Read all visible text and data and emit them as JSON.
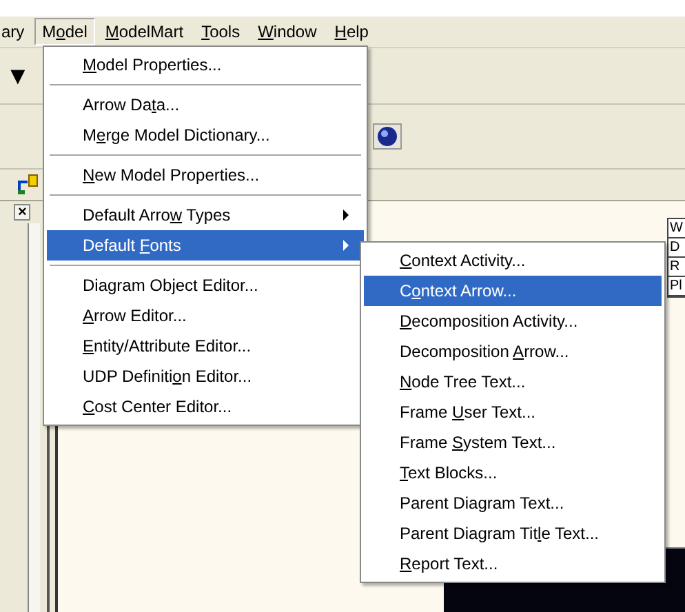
{
  "menu_bar": [
    {
      "label": {
        "after": "ary"
      },
      "open": false
    },
    {
      "label": {
        "before": "M",
        "key": "o",
        "after": "del"
      },
      "open": true
    },
    {
      "label": {
        "key": "M",
        "after": "odelMart"
      },
      "open": false
    },
    {
      "label": {
        "key": "T",
        "after": "ools"
      },
      "open": false
    },
    {
      "label": {
        "key": "W",
        "after": "indow"
      },
      "open": false
    },
    {
      "label": {
        "key": "H",
        "after": "elp"
      },
      "open": false
    }
  ],
  "model_menu": [
    {
      "kind": "item",
      "label": {
        "key": "M",
        "after": "odel Properties..."
      },
      "submenu": false,
      "selected": false
    },
    {
      "kind": "separator"
    },
    {
      "kind": "item",
      "label": {
        "before": "Arrow Da",
        "key": "t",
        "after": "a..."
      },
      "submenu": false,
      "selected": false
    },
    {
      "kind": "item",
      "label": {
        "before": "M",
        "key": "e",
        "after": "rge Model Dictionary..."
      },
      "submenu": false,
      "selected": false
    },
    {
      "kind": "separator"
    },
    {
      "kind": "item",
      "label": {
        "key": "N",
        "after": "ew Model Properties..."
      },
      "submenu": false,
      "selected": false
    },
    {
      "kind": "separator"
    },
    {
      "kind": "item",
      "label": {
        "before": "Default Arro",
        "key": "w",
        "after": " Types"
      },
      "submenu": true,
      "selected": false
    },
    {
      "kind": "item",
      "label": {
        "before": "Default ",
        "key": "F",
        "after": "onts"
      },
      "submenu": true,
      "selected": true
    },
    {
      "kind": "separator"
    },
    {
      "kind": "item",
      "label": {
        "before": "Diagram Object Editor..."
      },
      "submenu": false,
      "selected": false
    },
    {
      "kind": "item",
      "label": {
        "key": "A",
        "after": "rrow Editor..."
      },
      "submenu": false,
      "selected": false
    },
    {
      "kind": "item",
      "label": {
        "key": "E",
        "after": "ntity/Attribute Editor..."
      },
      "submenu": false,
      "selected": false
    },
    {
      "kind": "item",
      "label": {
        "before": "UDP Definiti",
        "key": "o",
        "after": "n Editor..."
      },
      "submenu": false,
      "selected": false
    },
    {
      "kind": "item",
      "label": {
        "key": "C",
        "after": "ost Center Editor..."
      },
      "submenu": false,
      "selected": false
    }
  ],
  "default_fonts_menu": [
    {
      "label": {
        "key": "C",
        "after": "ontext Activity..."
      },
      "selected": false
    },
    {
      "label": {
        "before": "C",
        "key": "o",
        "after": "ntext Arrow..."
      },
      "selected": true
    },
    {
      "label": {
        "key": "D",
        "after": "ecomposition Activity..."
      },
      "selected": false
    },
    {
      "label": {
        "before": "Decomposition ",
        "key": "A",
        "after": "rrow..."
      },
      "selected": false
    },
    {
      "label": {
        "key": "N",
        "after": "ode Tree Text..."
      },
      "selected": false
    },
    {
      "label": {
        "before": "Frame ",
        "key": "U",
        "after": "ser Text..."
      },
      "selected": false
    },
    {
      "label": {
        "before": "Frame ",
        "key": "S",
        "after": "ystem Text..."
      },
      "selected": false
    },
    {
      "label": {
        "key": "T",
        "after": "ext Blocks..."
      },
      "selected": false
    },
    {
      "label": {
        "before": "Parent Diagram Text..."
      },
      "selected": false
    },
    {
      "label": {
        "before": "Parent Diagram Tit",
        "key": "l",
        "after": "e Text..."
      },
      "selected": false
    },
    {
      "label": {
        "key": "R",
        "after": "eport Text..."
      },
      "selected": false
    }
  ],
  "toolbar": {
    "dropdown_glyph": "▼",
    "close_glyph": "×"
  },
  "table": {
    "column_1": [
      "W",
      "D",
      "R",
      "Pl"
    ]
  }
}
